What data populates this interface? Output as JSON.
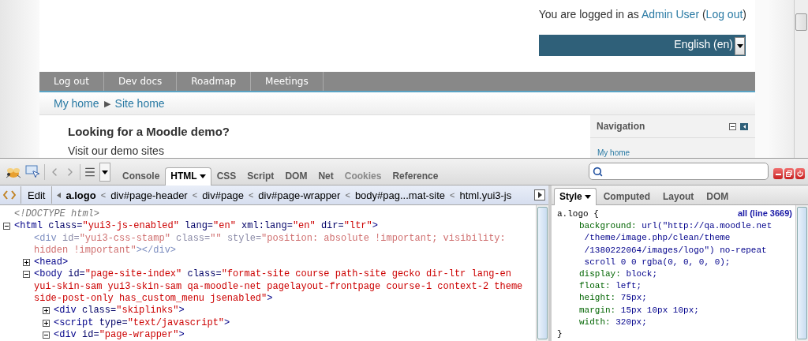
{
  "site": {
    "login": {
      "prefix": "You are logged in as",
      "user": "Admin User",
      "open": "(",
      "logout": "Log out",
      "close": ")"
    },
    "language": "English (en)",
    "menu": [
      "Log out",
      "Dev docs",
      "Roadmap",
      "Meetings"
    ],
    "breadcrumb": {
      "items": [
        "My home",
        "Site home"
      ],
      "separator": "▶"
    },
    "heading": "Looking for a Moodle demo?",
    "intro": "Visit our demo sites",
    "navigation": {
      "title": "Navigation",
      "items": [
        "My home"
      ]
    }
  },
  "firebug": {
    "tabs": [
      {
        "label": "Console",
        "selected": false,
        "menu": false,
        "disabled": false
      },
      {
        "label": "HTML",
        "selected": true,
        "menu": true,
        "disabled": false
      },
      {
        "label": "CSS",
        "selected": false,
        "menu": false,
        "disabled": false
      },
      {
        "label": "Script",
        "selected": false,
        "menu": false,
        "disabled": false
      },
      {
        "label": "DOM",
        "selected": false,
        "menu": false,
        "disabled": false
      },
      {
        "label": "Net",
        "selected": false,
        "menu": false,
        "disabled": false
      },
      {
        "label": "Cookies",
        "selected": false,
        "menu": false,
        "disabled": true
      },
      {
        "label": "Reference",
        "selected": false,
        "menu": false,
        "disabled": false
      }
    ],
    "edit_button": "Edit",
    "path": [
      {
        "label": "a.logo",
        "selected": true
      },
      {
        "label": "div#page-header",
        "selected": false
      },
      {
        "label": "div#page",
        "selected": false
      },
      {
        "label": "div#page-wrapper",
        "selected": false
      },
      {
        "label": "body#pag...mat-site",
        "selected": false
      },
      {
        "label": "html.yui3-js",
        "selected": false
      }
    ],
    "path_separator": "<",
    "html_tree": [
      {
        "kind": "doctype",
        "markup": "<!DOCTYPE html>"
      },
      {
        "kind": "element",
        "markup": "<html class=\"yui3-js-enabled\" lang=\"en\" xml:lang=\"en\" dir=\"ltr\">",
        "expanded": true,
        "children": [
          {
            "kind": "stamp",
            "markup": "<div id=\"yui3-css-stamp\" class=\"\" style=\"position: absolute !important; visibility: hidden !important\"></div>"
          },
          {
            "kind": "element",
            "markup": "<head>",
            "expanded": false
          },
          {
            "kind": "element",
            "markup": "<body id=\"page-site-index\" class=\"format-site course path-site gecko dir-ltr lang-en yui-skin-sam yui3-skin-sam qa-moodle-net pagelayout-frontpage course-1 context-2 theme side-post-only has_custom_menu jsenabled\">",
            "expanded": true,
            "children": [
              {
                "kind": "element",
                "markup": "<div class=\"skiplinks\">",
                "expanded": false
              },
              {
                "kind": "element",
                "markup": "<script type=\"text/javascript\">",
                "expanded": false
              },
              {
                "kind": "element",
                "markup": "<div id=\"page-wrapper\">",
                "expanded": true
              }
            ]
          }
        ]
      }
    ],
    "side_tabs": [
      {
        "label": "Style",
        "selected": true,
        "menu": true
      },
      {
        "label": "Computed",
        "selected": false,
        "menu": false
      },
      {
        "label": "Layout",
        "selected": false,
        "menu": false
      },
      {
        "label": "DOM",
        "selected": false,
        "menu": false
      }
    ],
    "rule": {
      "selector": "a.logo {",
      "source": "all (line 3669)",
      "properties": [
        {
          "name": "background:",
          "value_lines": [
            "url(\"http://qa.moodle.net",
            "/theme/image.php/clean/theme",
            "/1380222064/images/logo\") no-repeat",
            "scroll 0 0 rgba(0, 0, 0, 0);"
          ]
        },
        {
          "name": "display:",
          "value_lines": [
            "block;"
          ]
        },
        {
          "name": "float:",
          "value_lines": [
            "left;"
          ]
        },
        {
          "name": "height:",
          "value_lines": [
            "75px;"
          ]
        },
        {
          "name": "margin:",
          "value_lines": [
            "15px 10px 10px;"
          ]
        },
        {
          "name": "width:",
          "value_lines": [
            "320px;"
          ]
        }
      ],
      "close": "}"
    }
  }
}
